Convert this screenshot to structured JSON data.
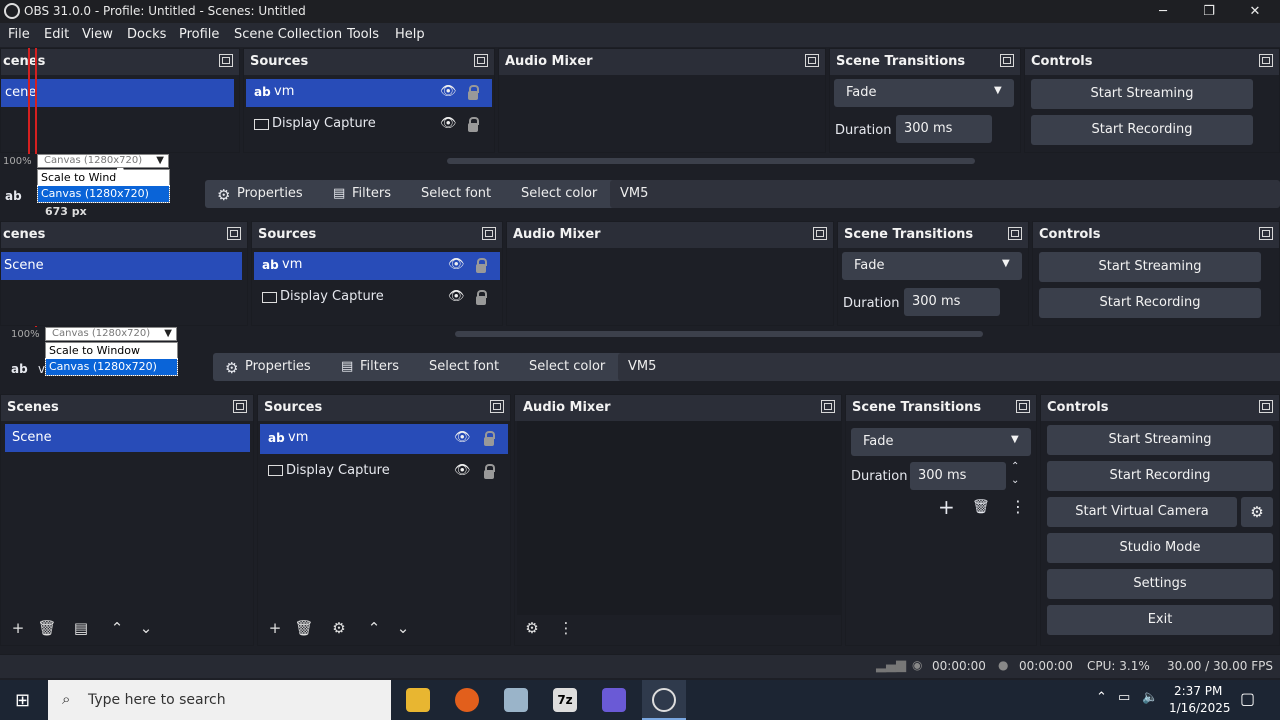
{
  "window": {
    "title": "OBS 31.0.0 - Profile: Untitled - Scenes: Untitled",
    "minimize": "─",
    "restore": "❐",
    "close": "✕"
  },
  "menu": [
    "File",
    "Edit",
    "View",
    "Docks",
    "Profile",
    "Scene Collection",
    "Tools",
    "Help"
  ],
  "docks": {
    "scenes": "Scenes",
    "sources": "Sources",
    "audio_mixer": "Audio Mixer",
    "scene_transitions": "Scene Transitions",
    "controls": "Controls"
  },
  "ghost": {
    "scenes_label": "cenes",
    "scene_item": "cene",
    "scenes_label2": "Scenes",
    "scene_item2": "Scene",
    "zoom": "100%",
    "canvas_combo": "Canvas (1280x720)",
    "scale_to_window": "Scale to Window",
    "scale_to_window_cut": "Scale to Windo",
    "canvas_option": "Canvas (1280x720)",
    "px_label": "673 px",
    "ab": "ab",
    "v": "v"
  },
  "scenes": {
    "items": [
      "Scene"
    ]
  },
  "sources": {
    "items": [
      {
        "icon": "ab",
        "name": "vm",
        "selected": true
      },
      {
        "icon": "monitor",
        "name": "Display Capture",
        "selected": false
      }
    ]
  },
  "source_toolbar": {
    "properties": "Properties",
    "filters": "Filters",
    "select_font": "Select font",
    "select_color": "Select color",
    "text_value": "VM5"
  },
  "transitions": {
    "type": "Fade",
    "duration_label": "Duration",
    "duration_value": "300 ms"
  },
  "controls": {
    "start_streaming": "Start Streaming",
    "start_recording": "Start Recording",
    "start_virtual_camera": "Start Virtual Camera",
    "studio_mode": "Studio Mode",
    "settings": "Settings",
    "exit": "Exit"
  },
  "status": {
    "stream_time": "00:00:00",
    "record_time": "00:00:00",
    "cpu": "CPU: 3.1%",
    "fps": "30.00 / 30.00 FPS"
  },
  "taskbar": {
    "search_placeholder": "Type here to search",
    "time": "2:37 PM",
    "date": "1/16/2025",
    "sevenzip": "7z"
  },
  "colors": {
    "accent": "#284cb8",
    "panel": "#272a33",
    "body": "#1d1f26"
  }
}
